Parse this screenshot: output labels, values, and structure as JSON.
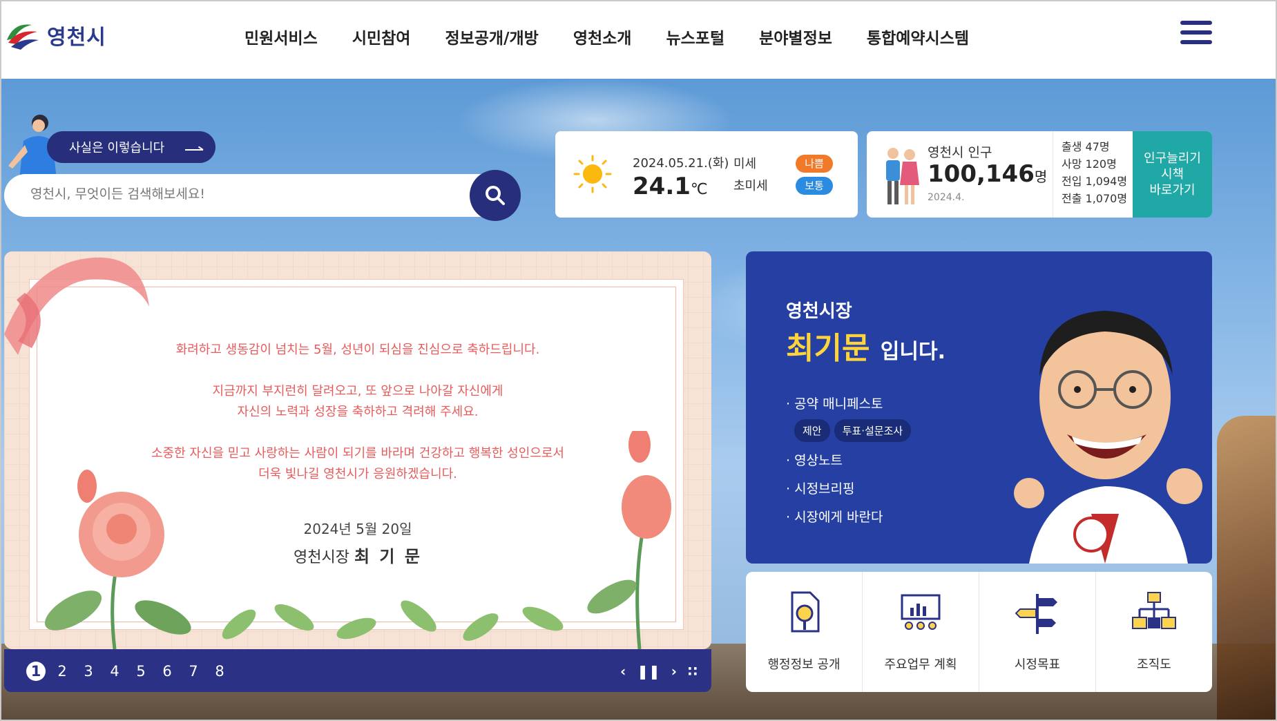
{
  "header": {
    "logo_text": "영천시",
    "nav": [
      "민원서비스",
      "시민참여",
      "정보공개/개방",
      "영천소개",
      "뉴스포털",
      "분야별정보",
      "통합예약시스템"
    ]
  },
  "search": {
    "badge_label": "사실은 이렇습니다",
    "placeholder": "영천시, 무엇이든 검색해보세요!"
  },
  "weather": {
    "date": "2024.05.21.(화)",
    "temp": "24.1",
    "temp_unit": "℃",
    "fine_dust_label": "미세",
    "fine_dust_status": "나쁨",
    "ultra_fine_dust_label": "초미세",
    "ultra_fine_dust_status": "보통",
    "colors": {
      "bad": "#f07a2a",
      "normal": "#2a8be0"
    }
  },
  "population": {
    "label": "영천시 인구",
    "count": "100,146",
    "unit": "명",
    "date": "2024.4.",
    "stats": [
      "출생 47명",
      "사망 120명",
      "전입 1,094명",
      "전출 1,070명"
    ],
    "link_label_lines": [
      "인구늘리기",
      "시책",
      "바로가기"
    ]
  },
  "banner": {
    "lines": [
      "화려하고 생동감이 넘치는 5월, 성년이 되심을 진심으로 축하드립니다.",
      "지금까지 부지런히 달려오고, 또 앞으로 나아갈 자신에게",
      "자신의 노력과 성장을 축하하고 격려해 주세요.",
      "소중한 자신을 믿고 사랑하는 사람이 되기를 바라며 건강하고 행복한 성인으로서",
      "더욱 빛나길 영천시가 응원하겠습니다."
    ],
    "date": "2024년 5월 20일",
    "sign_prefix": "영천시장",
    "sign_name": "최 기 문",
    "pages": [
      "1",
      "2",
      "3",
      "4",
      "5",
      "6",
      "7",
      "8"
    ],
    "active_page": "1",
    "controls": {
      "prev": "‹",
      "pause": "❚❚",
      "next": "›",
      "all": "∷"
    }
  },
  "mayor": {
    "title": "영천시장",
    "name": "최기문",
    "name_suffix": "입니다.",
    "menu": [
      "공약 매니페스토",
      "영상노트",
      "시정브리핑",
      "시장에게 바란다"
    ],
    "tags": [
      "제안",
      "투표·설문조사"
    ]
  },
  "quick_links": [
    {
      "label": "행정정보 공개",
      "icon": "document-search-icon"
    },
    {
      "label": "주요업무 계획",
      "icon": "chart-board-icon"
    },
    {
      "label": "시정목표",
      "icon": "signpost-icon"
    },
    {
      "label": "조직도",
      "icon": "org-chart-icon"
    }
  ],
  "colors": {
    "primary": "#272e7b",
    "accent": "#1fa8a6",
    "mayor_bg": "#2540a2",
    "mayor_name": "#ffd43b"
  }
}
